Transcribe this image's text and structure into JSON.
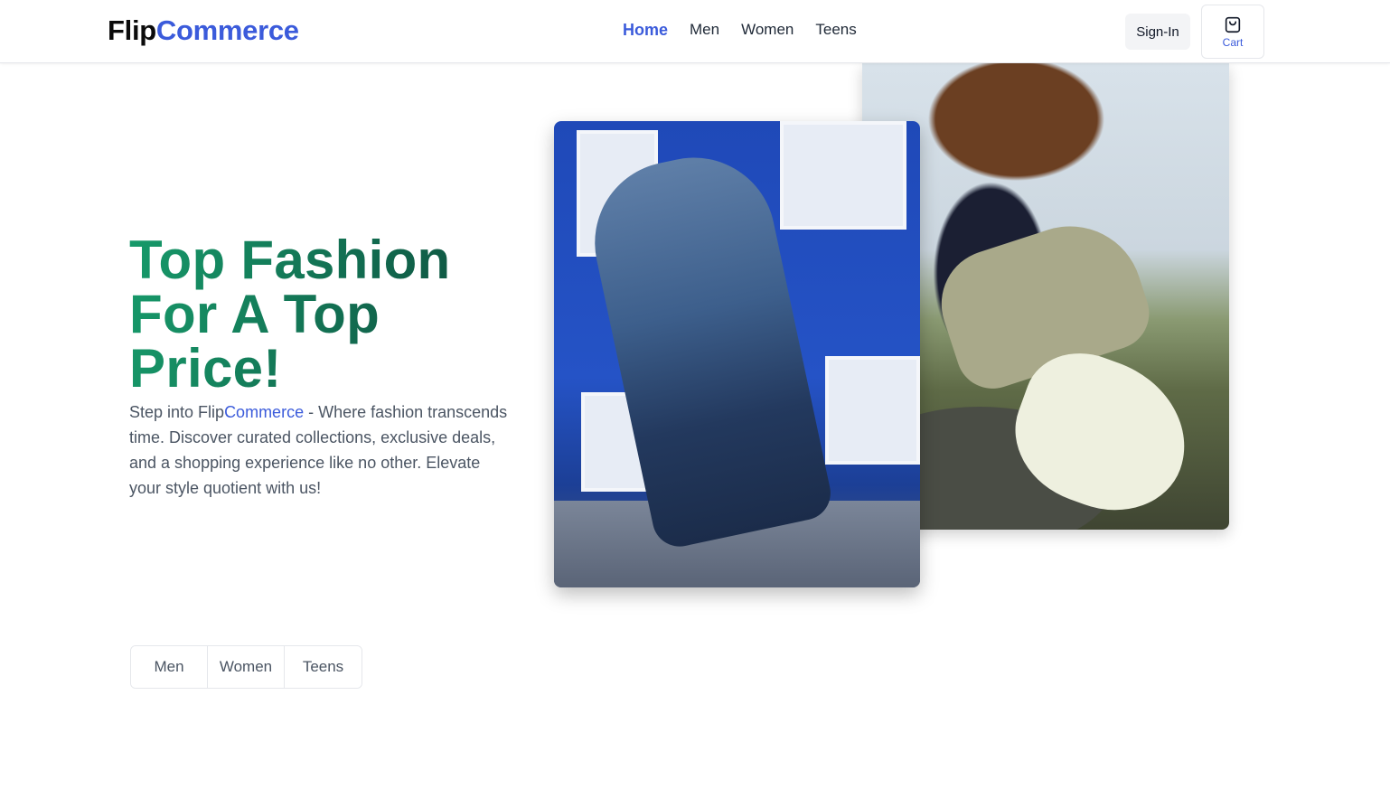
{
  "header": {
    "logo_part1": "Flip",
    "logo_part2": "Commerce",
    "nav": [
      "Home",
      "Men",
      "Women",
      "Teens"
    ],
    "signin_label": "Sign-In",
    "cart_label": "Cart"
  },
  "hero": {
    "title": "Top Fashion For A Top Price!",
    "desc_prefix": "Step into Flip",
    "desc_brand": "Commerce",
    "desc_suffix": " - Where fashion transcends time. Discover curated collections, exclusive deals, and a shopping experience like no other. Elevate your style quotient with us!"
  },
  "categories": [
    "Men",
    "Women",
    "Teens"
  ],
  "colors": {
    "brand_blue": "#3b5bdb",
    "title_green": "#179a6a"
  },
  "icons": {
    "cart": "shopping-bag-icon"
  }
}
